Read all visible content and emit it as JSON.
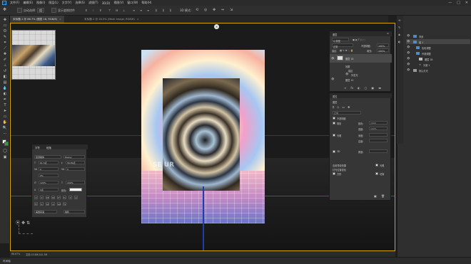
{
  "menu": {
    "logo": "Ps",
    "items": [
      "文件(F)",
      "编辑(E)",
      "图像(I)",
      "图层(L)",
      "文字(Y)",
      "选择(S)",
      "滤镜(T)",
      "3D(D)",
      "视图(V)",
      "窗口(W)",
      "帮助(H)"
    ],
    "window_controls": [
      "—",
      "□",
      "✕"
    ]
  },
  "options_bar": {
    "auto_select_label": "自动选择:",
    "auto_select_value": "组",
    "transform_label": "显示变换控件",
    "mode_3d_label": "3D 模式:"
  },
  "tabs": [
    {
      "label": "未标题-1 @ 66.7% (图层 18, RGB/8)",
      "active": true
    },
    {
      "label": "未标题-2 @ 28.5% (Mask Image, RGB/8)",
      "active": false
    }
  ],
  "canvas": {
    "artboard_text": "SE UR",
    "close_glyph": "✕"
  },
  "status": {
    "zoom": "66.67%",
    "doc_size": "文档:15.6M/142.3M",
    "timeline_label": "时间轴"
  },
  "properties_panel": {
    "tabs": [
      "字符",
      "段落"
    ],
    "font_family": "思源黑体",
    "font_style": "Heavy",
    "size_value": "61.5点",
    "leading_value": "56.89点",
    "tracking_label": "VA",
    "tracking_value": "0",
    "kerning_value": "0",
    "percent_label": "0%",
    "scale_v": "100%",
    "scale_h": "100%",
    "baseline_value": "0点",
    "color_label": "颜色:",
    "language_value": "美国英语",
    "aa_value": "锐利"
  },
  "layers_panel": {
    "title": "图层",
    "kind_label": "Q 类型",
    "blend_mode": "正常",
    "opacity_label": "不透明度:",
    "opacity_value": "100%",
    "lock_label": "锁定:",
    "fill_label": "填充:",
    "fill_value": "100%",
    "rows": [
      {
        "name": "图层 18",
        "selected": true
      },
      {
        "name": "效果",
        "selected": false
      },
      {
        "name": "描边",
        "selected": false
      },
      {
        "name": "外发光",
        "selected": false
      },
      {
        "name": "图层 15",
        "selected": false
      }
    ],
    "bottom_icons": [
      "fx",
      "◐",
      "▢",
      "▣",
      "▬",
      "🗑"
    ]
  },
  "properties2": {
    "title": "属性",
    "section": "图层",
    "blend_label": "正常",
    "option1": "不透明度",
    "option2": "3D",
    "field1_label": "颜色:",
    "field1_value": "1500",
    "field2_label": "强度:",
    "field2_value": "100%",
    "field3_label": "深度:",
    "field4_label": "高度:",
    "field5_label": "角度:",
    "checkbox1": "阴影",
    "checkbox2": "光照",
    "checkbox3": "投影",
    "footer1": "应用预设效果",
    "footer2": "灯光位置变化",
    "footer3": "方形",
    "footer4": "光照",
    "footer5": "切换"
  },
  "right_dock": {
    "rows": [
      {
        "name": "背景",
        "selected": false
      },
      {
        "name": "组 1",
        "selected": true
      },
      {
        "name": "色彩调整",
        "selected": false
      },
      {
        "name": "外观调整",
        "selected": false
      },
      {
        "name": "图层 18",
        "selected": false
      },
      {
        "name": "光源 1",
        "selected": false
      },
      {
        "name": "默认灯光",
        "selected": false
      }
    ]
  },
  "colors": {
    "accent_blue": "#31a8ff",
    "frame_yellow": "#d4a400",
    "horizon_red": "#c3231c",
    "panel_bg": "#363636"
  }
}
